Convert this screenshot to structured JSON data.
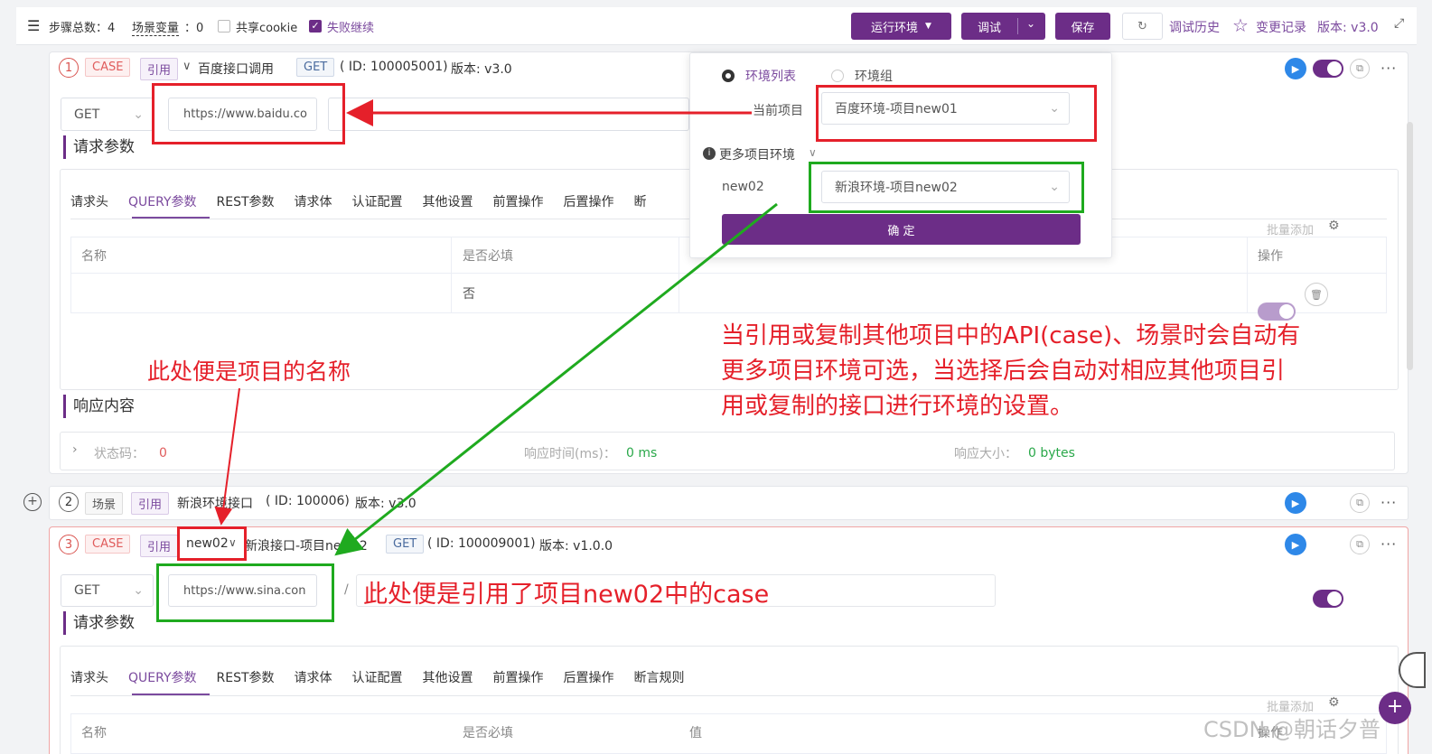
{
  "toolbar": {
    "menu_icon": "hamburger-icon",
    "steps_label": "步骤总数：4",
    "scene_vars_label": "场景变量",
    "scene_vars_value": "：0",
    "share_cookie_label": "共享cookie",
    "fail_continue_label": "失败继续",
    "run_env_label": "运行环境",
    "debug_label": "调试",
    "save_label": "保存",
    "history_label": "调试历史",
    "changes_label": "变更记录",
    "version_label": "版本: v3.0"
  },
  "step1": {
    "num": "1",
    "type_tag": "CASE",
    "ref_tag": "引用",
    "name": "百度接口调用",
    "method_tag": "GET",
    "id_text": "( ID: 100005001)",
    "version_text": "版本: v3.0",
    "method_select": "GET",
    "url": "https://www.baidu.co",
    "slash": "/"
  },
  "request_params_title": "请求参数",
  "tabs": [
    "请求头",
    "QUERY参数",
    "REST参数",
    "请求体",
    "认证配置",
    "其他设置",
    "前置操作",
    "后置操作",
    "断言规则"
  ],
  "tab_partial": "断",
  "batch_add_label": "批量添加",
  "table": {
    "col_name": "名称",
    "col_required": "是否必填",
    "col_value": "值",
    "col_action": "操作",
    "row1_required": "否"
  },
  "response": {
    "title": "响应内容",
    "status_label": "状态码：",
    "status_value": "0",
    "time_label": "响应时间(ms)：",
    "time_value": "0 ms",
    "size_label": "响应大小：",
    "size_value": "0 bytes"
  },
  "popup": {
    "radio_env_list": "环境列表",
    "radio_env_group": "环境组",
    "current_project_label": "当前项目",
    "current_project_value": "百度环境-项目new01",
    "more_envs_label": "更多项目环境",
    "new02_label": "new02",
    "new02_value": "新浪环境-项目new02",
    "confirm_label": "确 定"
  },
  "step2": {
    "num": "2",
    "type_tag": "场景",
    "ref_tag": "引用",
    "name": "新浪环境接口",
    "id_text": "( ID: 100006)",
    "version_text": "版本: v3.0"
  },
  "step3": {
    "num": "3",
    "type_tag": "CASE",
    "ref_tag": "引用",
    "project_select": "new02",
    "name": "新浪接口-项目new02",
    "method_tag": "GET",
    "id_text": "( ID: 100009001)",
    "version_text": "版本: v1.0.0",
    "method_select": "GET",
    "url": "https://www.sina.con",
    "slash": "/"
  },
  "annotations": {
    "project_name_note": "此处便是项目的名称",
    "more_env_note_line1": "当引用或复制其他项目中的API(case)、场景时会自动有",
    "more_env_note_line2": "更多项目环境可选，当选择后会自动对相应其他项目引",
    "more_env_note_line3": "用或复制的接口进行环境的设置。",
    "referenced_case_note": "此处便是引用了项目new02中的case"
  },
  "watermark": "CSDN @朝话夕普",
  "colors": {
    "accent": "#6c2d87",
    "annotation_red": "#e5202a",
    "annotation_green": "#1faa1f"
  }
}
